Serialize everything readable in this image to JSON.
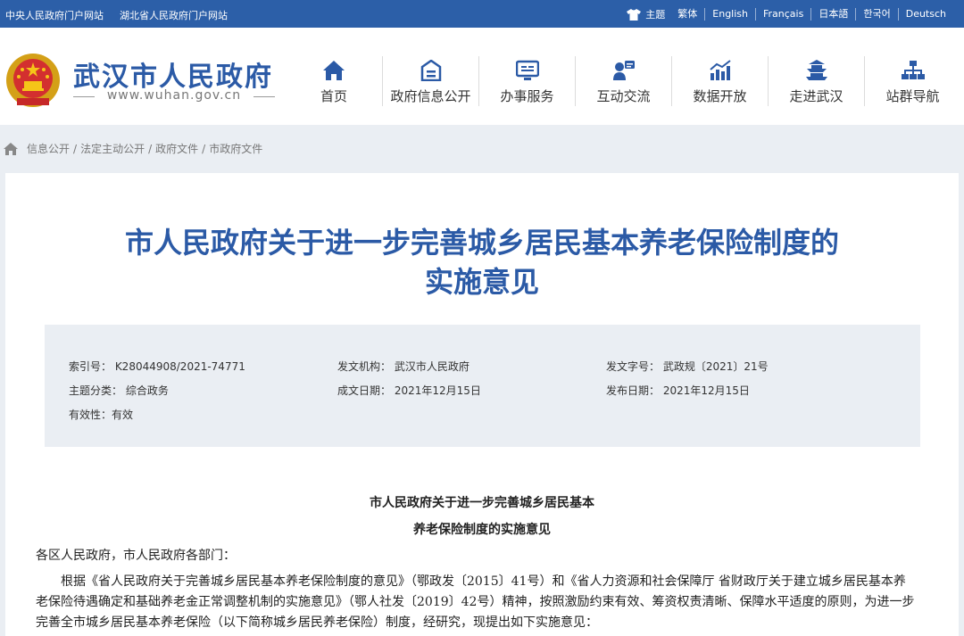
{
  "top_links": [
    "中央人民政府门户网站",
    "湖北省人民政府门户网站"
  ],
  "theme_label": "主题",
  "languages": [
    "繁体",
    "English",
    "Français",
    "日本語",
    "한국어",
    "Deutsch"
  ],
  "site": {
    "name": "武汉市人民政府",
    "domain": "www.wuhan.gov.cn"
  },
  "nav": [
    {
      "label": "首页",
      "icon": "home-icon"
    },
    {
      "label": "政府信息公开",
      "icon": "info-box-icon"
    },
    {
      "label": "办事服务",
      "icon": "service-monitor-icon"
    },
    {
      "label": "互动交流",
      "icon": "interaction-icon"
    },
    {
      "label": "数据开放",
      "icon": "chart-icon"
    },
    {
      "label": "走进武汉",
      "icon": "tower-icon"
    },
    {
      "label": "站群导航",
      "icon": "sitemap-icon"
    }
  ],
  "breadcrumb": [
    "信息公开",
    "法定主动公开",
    "政府文件",
    "市政府文件"
  ],
  "document": {
    "title_line1": "市人民政府关于进一步完善城乡居民基本养老保险制度的",
    "title_line2": "实施意见",
    "meta": {
      "index_no": "索引号： K28044908/2021-74771",
      "issuer": "发文机构： 武汉市人民政府",
      "doc_no": "发文字号： 武政规〔2021〕21号",
      "category": "主题分类： 综合政务",
      "written_date": "成文日期： 2021年12月15日",
      "publish_date": "发布日期： 2021年12月15日",
      "validity": "有效性：有效"
    },
    "subtitle_line1": "市人民政府关于进一步完善城乡居民基本",
    "subtitle_line2": "养老保险制度的实施意见",
    "salutation": "各区人民政府，市人民政府各部门：",
    "body_line1": "根据《省人民政府关于完善城乡居民基本养老保险制度的意见》（鄂政发〔2015〕41号）和《省人力资源和社会保障厅 省财政厅关于建立城乡居民基本养",
    "body_line2": "老保险待遇确定和基础养老金正常调整机制的实施意见》（鄂人社发〔2019〕42号）精神，按照激励约束有效、筹资权责清晰、保障水平适度的原则，为进一步",
    "body_line3": "完善全市城乡居民基本养老保险（以下简称城乡居民养老保险）制度，经研究，现提出如下实施意见："
  },
  "colors": {
    "primary": "#2c5fa8",
    "title_blue": "#2b5aa6",
    "meta_bg": "#eaeef3"
  }
}
